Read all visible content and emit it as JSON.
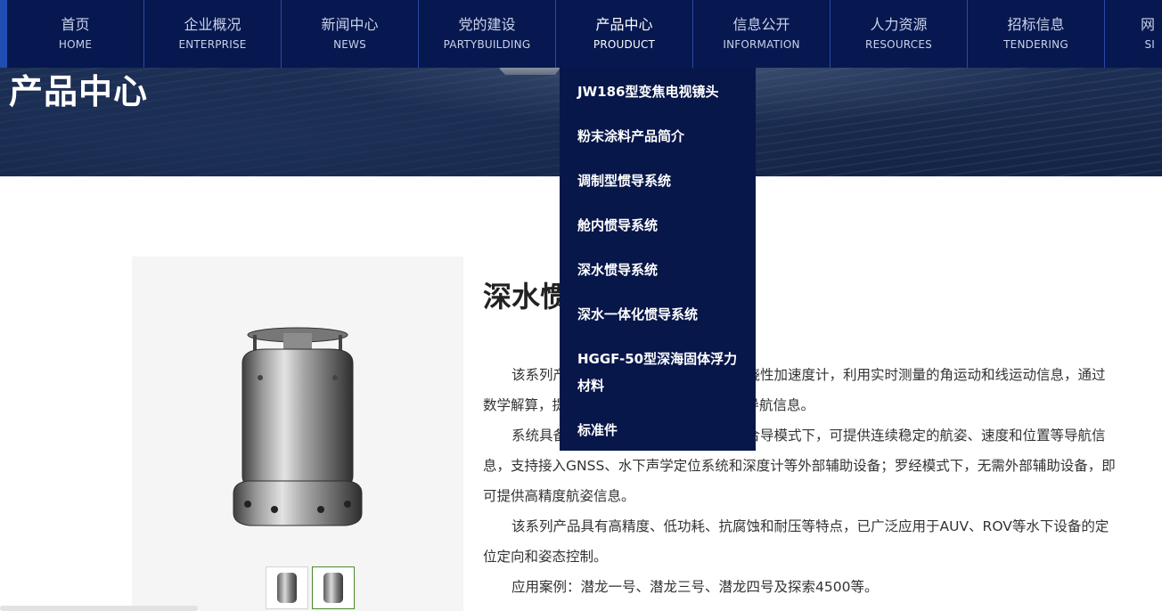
{
  "nav": {
    "items": [
      {
        "cn": "首页",
        "en": "HOME"
      },
      {
        "cn": "企业概况",
        "en": "ENTERPRISE"
      },
      {
        "cn": "新闻中心",
        "en": "NEWS"
      },
      {
        "cn": "党的建设",
        "en": "PARTYBUILDING"
      },
      {
        "cn": "产品中心",
        "en": "PROUDUCT"
      },
      {
        "cn": "信息公开",
        "en": "INFORMATION"
      },
      {
        "cn": "人力资源",
        "en": "RESOURCES"
      },
      {
        "cn": "招标信息",
        "en": "TENDERING"
      },
      {
        "cn": "网",
        "en": "SI"
      }
    ],
    "active_index": 4
  },
  "banner": {
    "title": "产品中心"
  },
  "dropdown": {
    "items": [
      "JW186型变焦电视镜头",
      "粉末涂料产品简介",
      "调制型惯导系统",
      "舱内惯导系统",
      "深水惯导系统",
      "深水一体化惯导系统",
      "HGGF-50型深海固体浮力材料",
      "标准件"
    ]
  },
  "product": {
    "title": "深水惯导系统",
    "paragraphs": [
      "该系列产品采用高精度光纤陀螺和石英挠性加速度计，利用实时测量的角运动和线运动信息，通过数学解算，提供载体的航姿、速度和位置等导航信息。",
      "系统具备组合导航和罗经两种模式：组合导模式下，可提供连续稳定的航姿、速度和位置等导航信息，支持接入GNSS、水下声学定位系统和深度计等外部辅助设备；罗经模式下，无需外部辅助设备，即可提供高精度航姿信息。",
      "该系列产品具有高精度、低功耗、抗腐蚀和耐压等特点，已广泛应用于AUV、ROV等水下设备的定位定向和姿态控制。",
      "应用案例：潜龙一号、潜龙三号、潜龙四号及探索4500等。"
    ],
    "thumbnails": 2,
    "active_thumbnail": 1
  },
  "colors": {
    "nav_bg": "#06184f",
    "dropdown_bg": "#07174a",
    "nav_divider": "#2a49a8",
    "thumb_active": "#4a8a2a"
  }
}
